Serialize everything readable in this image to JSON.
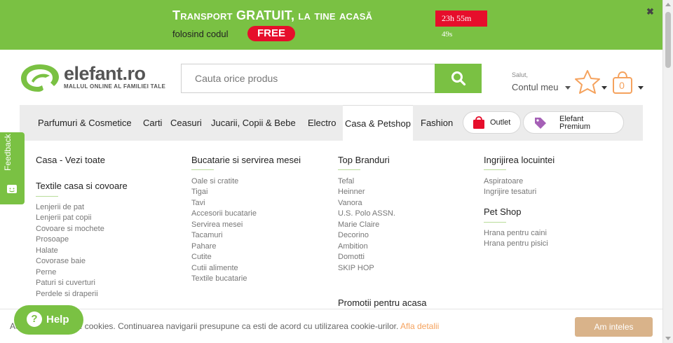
{
  "promo": {
    "line1": "Transport GRATUIT, la tine acasă",
    "line2": "folosind codul",
    "code": "FREE",
    "timer_main": "23h 55m",
    "timer_seconds": "49s",
    "close": "✖"
  },
  "header": {
    "logo_text": "elefant.ro",
    "logo_tagline": "MALLUL ONLINE AL FAMILIEI TALE",
    "search_placeholder": "Cauta orice produs",
    "greeting": "Salut,",
    "account_label": "Contul meu",
    "cart_count": "0"
  },
  "nav": {
    "items": [
      "Parfumuri & Cosmetice",
      "Carti",
      "Ceasuri",
      "Jucarii, Copii & Bebe",
      "Electro",
      "Casa & Petshop",
      "Fashion"
    ],
    "outlet": "Outlet",
    "premium_line1": "Elefant",
    "premium_line2": "Premium"
  },
  "mega": {
    "col1": {
      "title": "Casa - Vezi toate",
      "subtitle": "Textile casa si covoare",
      "links": [
        "Lenjerii de pat",
        "Lenjerii pat copii",
        "Covoare si mochete",
        "Prosoape",
        "Halate",
        "Covorase baie",
        "Perne",
        "Paturi si cuverturi",
        "Perdele si draperii"
      ]
    },
    "col2": {
      "title": "Bucatarie si servirea mesei",
      "links": [
        "Oale si cratite",
        "Tigai",
        "Tavi",
        "Accesorii bucatarie",
        "Servirea mesei",
        "Tacamuri",
        "Pahare",
        "Cutite",
        "Cutii alimente",
        "Textile bucatarie"
      ]
    },
    "col3": {
      "title": "Top Branduri",
      "links": [
        "Tefal",
        "Heinner",
        "Vanora",
        "U.S. Polo ASSN.",
        "Marie Claire",
        "Decorino",
        "Ambition",
        "Domotti",
        "SKIP HOP"
      ],
      "promo_title": "Promotii pentru acasa"
    },
    "col4": {
      "title": "Ingrijirea locuintei",
      "links": [
        "Aspiratoare",
        "Ingrijire tesaturi"
      ],
      "pet_title": "Pet Shop",
      "pet_links": [
        "Hrana pentru caini",
        "Hrana pentru pisici"
      ]
    }
  },
  "feedback": {
    "label": "Feedback"
  },
  "cookie": {
    "text": "Acest site foloseste cookies. Continuarea navigarii presupune ca esti de acord cu utilizarea cookie-urilor.",
    "link": "Afla detalii",
    "button": "Am inteles"
  },
  "help": {
    "icon": "?",
    "label": "Help"
  }
}
